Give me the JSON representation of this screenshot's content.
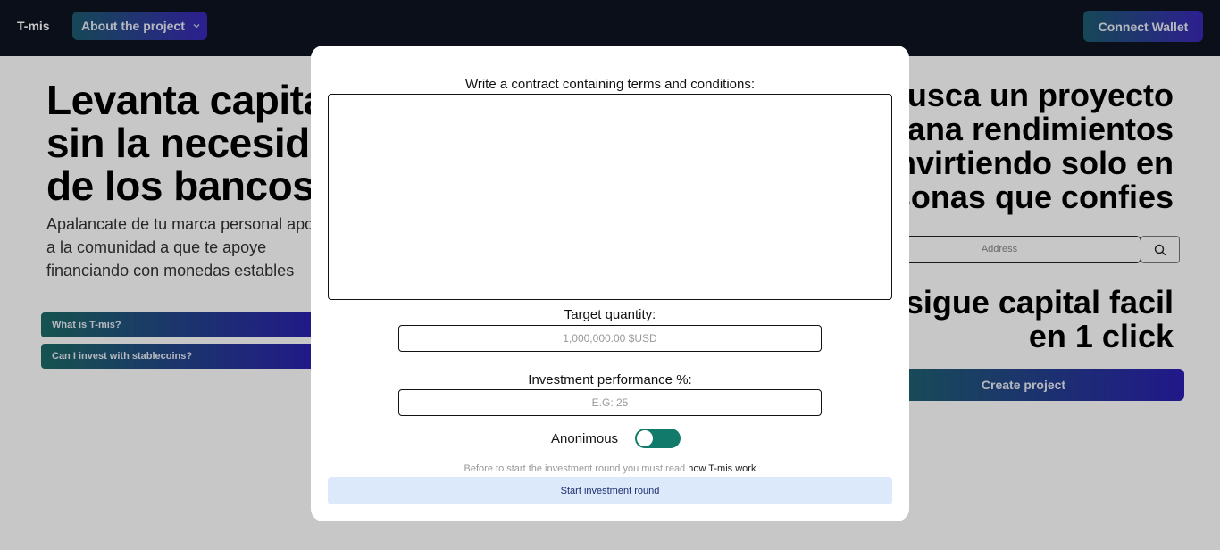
{
  "navbar": {
    "brand": "T-mis",
    "about_label": "About the project",
    "connect_label": "Connect Wallet"
  },
  "left": {
    "title_lines": [
      "Levanta capital",
      "sin la necesidad",
      "de los bancos"
    ],
    "subtitle_lines": [
      "Apalancate de tu marca personal apoyate",
      "a la comunidad a que te apoye",
      "financiando con monedas estables"
    ],
    "faq": [
      "What is T-mis?",
      "Can I invest with stablecoins?"
    ]
  },
  "right": {
    "title1_lines": [
      "Busca un proyecto",
      "y gana rendimientos",
      "invirtiendo solo en",
      "personas que confies"
    ],
    "address_placeholder": "Address",
    "title2_lines": [
      "Consigue capital facil",
      "en 1 click"
    ],
    "create_label": "Create project"
  },
  "modal": {
    "terms_label": "Write a contract containing terms and conditions:",
    "terms_value": "",
    "target_label": "Target quantity:",
    "target_placeholder": "1,000,000.00 $USD",
    "performance_label": "Investment performance %:",
    "performance_placeholder": "E.G: 25",
    "anon_label": "Anonimous",
    "anon_enabled": true,
    "notice_text": "Before to start the investment round you must read",
    "notice_link": "how T-mis work",
    "start_label": "Start investment round"
  },
  "colors": {
    "navbar_bg": "#0f1420",
    "toggle_on": "#127a6a",
    "start_button_bg": "#dbe9fb"
  }
}
